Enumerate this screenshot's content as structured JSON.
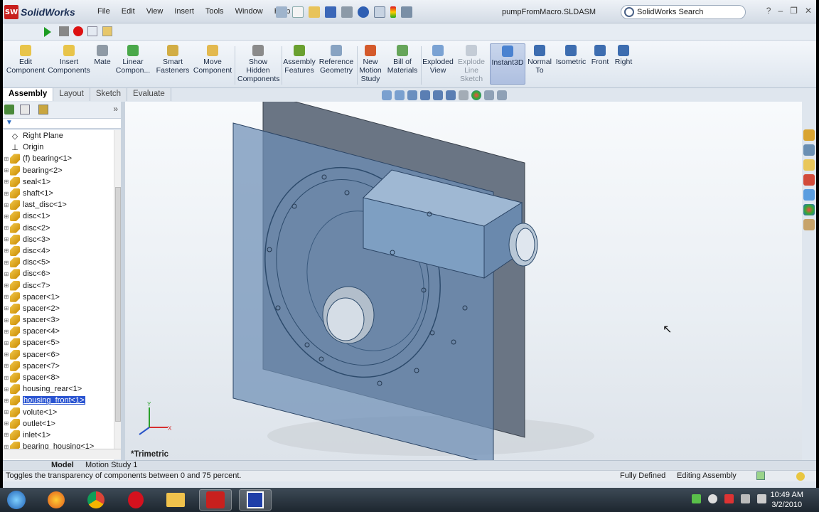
{
  "app": {
    "name": "SolidWorks",
    "logo_text": "SW"
  },
  "menu": [
    "File",
    "Edit",
    "View",
    "Insert",
    "Tools",
    "Window",
    "Help"
  ],
  "document_title": "pumpFromMacro.SLDASM",
  "search": {
    "placeholder": "SolidWorks Search"
  },
  "window_controls": {
    "help": "?",
    "minimize": "–",
    "restore": "❐",
    "close": "✕"
  },
  "command_manager": [
    {
      "label": "Edit\nComponent"
    },
    {
      "label": "Insert\nComponents"
    },
    {
      "label": "Mate"
    },
    {
      "label": "Linear\nCompon..."
    },
    {
      "label": "Smart\nFasteners"
    },
    {
      "label": "Move\nComponent"
    },
    {
      "label": "Show\nHidden\nComponents"
    },
    {
      "label": "Assembly\nFeatures"
    },
    {
      "label": "Reference\nGeometry"
    },
    {
      "label": "New\nMotion\nStudy"
    },
    {
      "label": "Bill of\nMaterials"
    },
    {
      "label": "Exploded\nView"
    },
    {
      "label": "Explode\nLine\nSketch"
    },
    {
      "label": "Instant3D"
    },
    {
      "label": "Normal\nTo"
    },
    {
      "label": "Isometric"
    },
    {
      "label": "Front"
    },
    {
      "label": "Right"
    }
  ],
  "tabs": [
    "Assembly",
    "Layout",
    "Sketch",
    "Evaluate"
  ],
  "tree": [
    {
      "label": "Right Plane",
      "icon": "plane"
    },
    {
      "label": "Origin",
      "icon": "origin"
    },
    {
      "label": "(f) bearing<1>",
      "icon": "part"
    },
    {
      "label": "bearing<2>",
      "icon": "part"
    },
    {
      "label": "seal<1>",
      "icon": "part"
    },
    {
      "label": "shaft<1>",
      "icon": "part"
    },
    {
      "label": "last_disc<1>",
      "icon": "part"
    },
    {
      "label": "disc<1>",
      "icon": "part"
    },
    {
      "label": "disc<2>",
      "icon": "part"
    },
    {
      "label": "disc<3>",
      "icon": "part"
    },
    {
      "label": "disc<4>",
      "icon": "part"
    },
    {
      "label": "disc<5>",
      "icon": "part"
    },
    {
      "label": "disc<6>",
      "icon": "part"
    },
    {
      "label": "disc<7>",
      "icon": "part"
    },
    {
      "label": "spacer<1>",
      "icon": "part"
    },
    {
      "label": "spacer<2>",
      "icon": "part"
    },
    {
      "label": "spacer<3>",
      "icon": "part"
    },
    {
      "label": "spacer<4>",
      "icon": "part"
    },
    {
      "label": "spacer<5>",
      "icon": "part"
    },
    {
      "label": "spacer<6>",
      "icon": "part"
    },
    {
      "label": "spacer<7>",
      "icon": "part"
    },
    {
      "label": "spacer<8>",
      "icon": "part"
    },
    {
      "label": "housing_rear<1>",
      "icon": "part"
    },
    {
      "label": "housing_front<1>",
      "icon": "part",
      "selected": true
    },
    {
      "label": "volute<1>",
      "icon": "part"
    },
    {
      "label": "outlet<1>",
      "icon": "part"
    },
    {
      "label": "inlet<1>",
      "icon": "part"
    },
    {
      "label": "bearing_housing<1>",
      "icon": "part"
    }
  ],
  "viewport": {
    "view_label": "*Trimetric",
    "triad_x": "X",
    "triad_y": "Y"
  },
  "bottom_tabs": [
    "Model",
    "Motion Study 1"
  ],
  "status": {
    "message": "Toggles the transparency of components between 0 and 75 percent.",
    "state": "Fully Defined",
    "mode": "Editing Assembly"
  },
  "taskbar": {
    "time": "10:49 AM",
    "date": "3/2/2010"
  },
  "colors": {
    "accent": "#2a54d1",
    "sw_red": "#c8201e",
    "model_blue": "#5b7fa8"
  }
}
